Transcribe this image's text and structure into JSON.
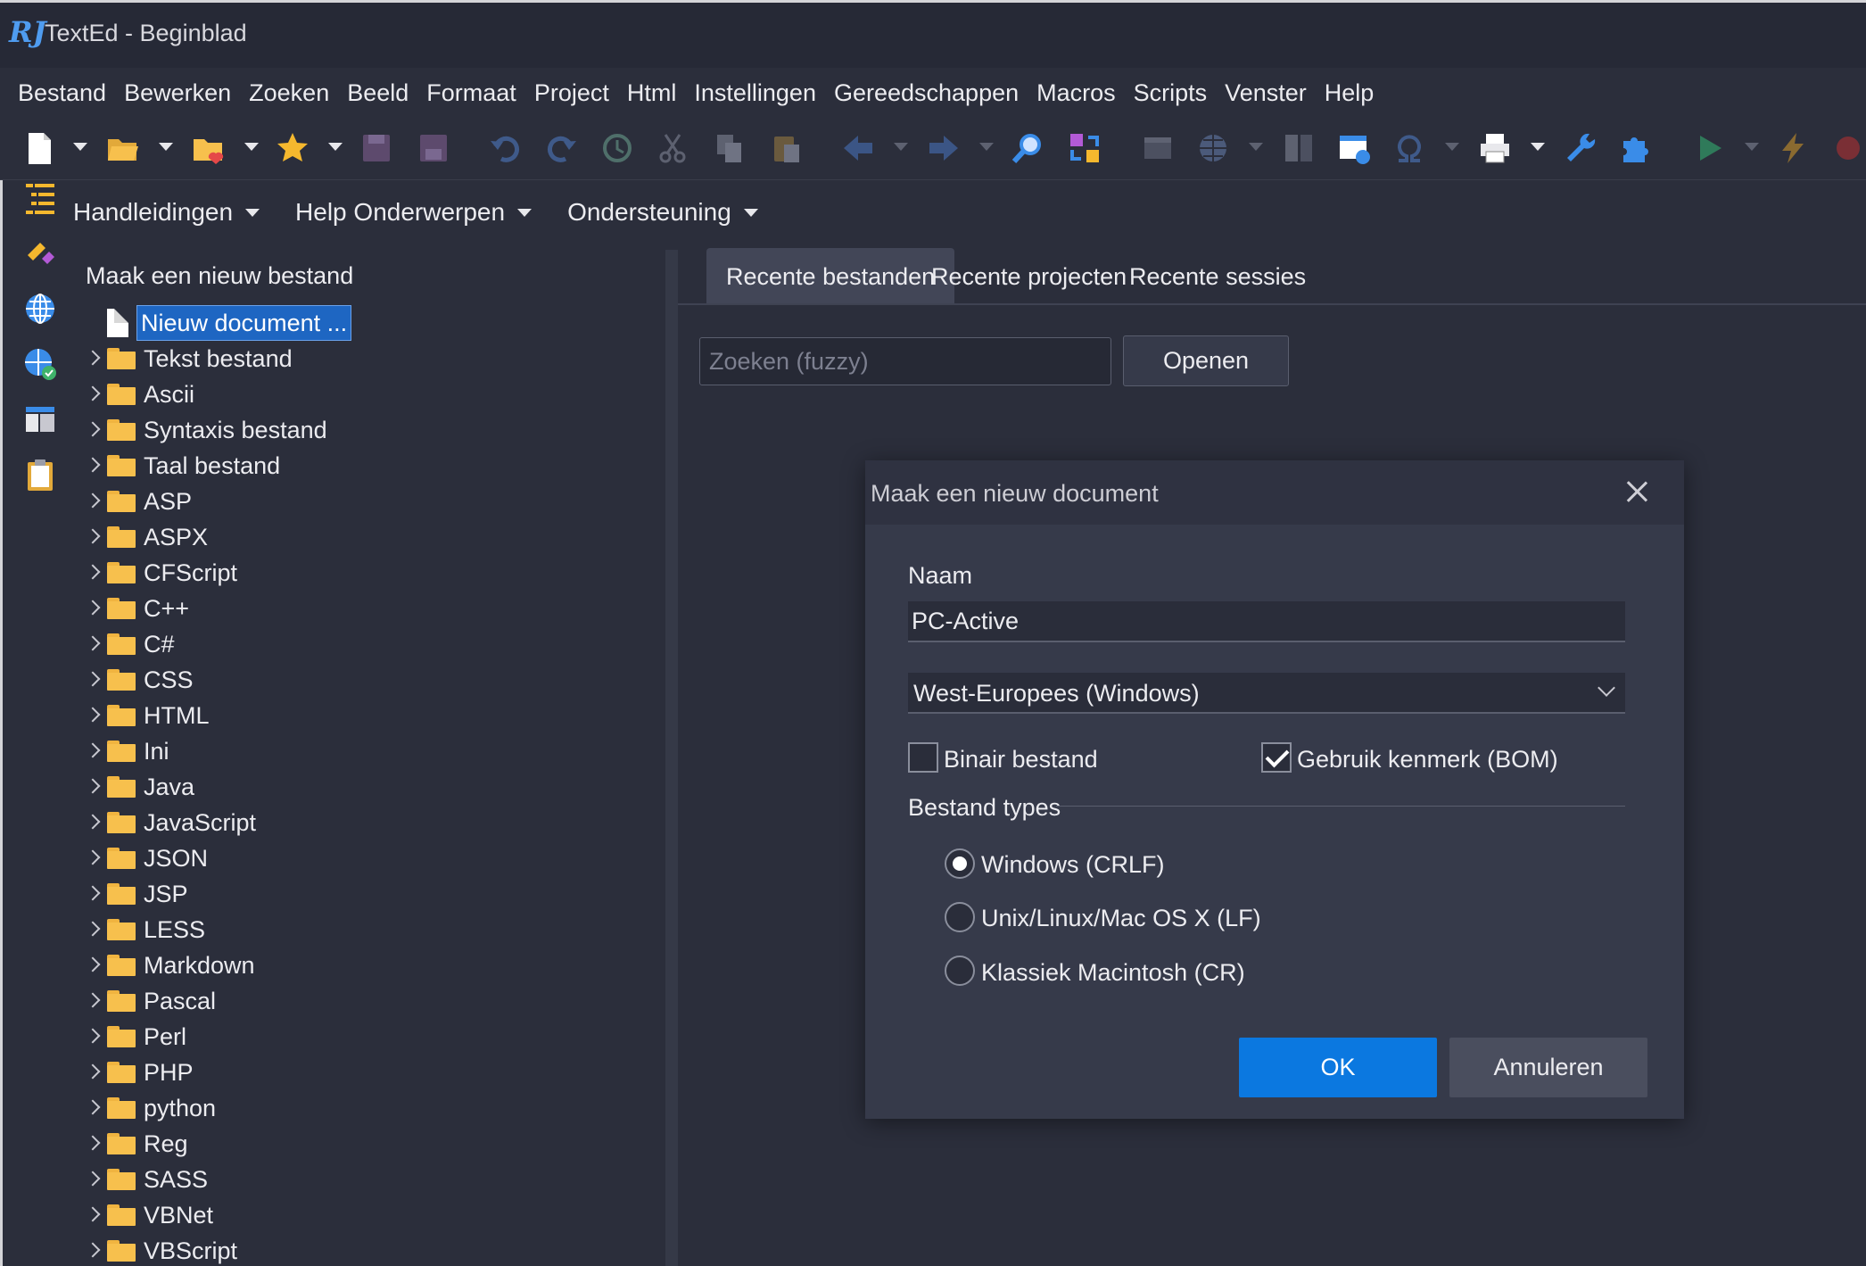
{
  "window": {
    "title": "TextEd - Beginblad",
    "logo_text": "RJ"
  },
  "menu": [
    "Bestand",
    "Bewerken",
    "Zoeken",
    "Beeld",
    "Formaat",
    "Project",
    "Html",
    "Instellingen",
    "Gereedschappen",
    "Macros",
    "Scripts",
    "Venster",
    "Help"
  ],
  "subbar": {
    "items": [
      "Handleidingen",
      "Help Onderwerpen",
      "Ondersteuning"
    ]
  },
  "tree": {
    "heading": "Maak een nieuw bestand",
    "selected_item": "Nieuw document ...",
    "folders": [
      "Tekst bestand",
      "Ascii",
      "Syntaxis bestand",
      "Taal bestand",
      "ASP",
      "ASPX",
      "CFScript",
      "C++",
      "C#",
      "CSS",
      "HTML",
      "Ini",
      "Java",
      "JavaScript",
      "JSON",
      "JSP",
      "LESS",
      "Markdown",
      "Pascal",
      "Perl",
      "PHP",
      "python",
      "Reg",
      "SASS",
      "VBNet",
      "VBScript"
    ]
  },
  "tabs": [
    {
      "label": "Recente bestanden",
      "active": true
    },
    {
      "label": "Recente projecten",
      "active": false
    },
    {
      "label": "Recente sessies",
      "active": false
    }
  ],
  "search": {
    "placeholder": "Zoeken (fuzzy)",
    "value": "",
    "open_label": "Openen"
  },
  "dialog": {
    "title": "Maak een nieuw document",
    "name_label": "Naam",
    "name_value": "PC-Active",
    "encoding_selected": "West-Europees (Windows)",
    "binary_label": "Binair bestand",
    "binary_checked": false,
    "bom_label": "Gebruik kenmerk (BOM)",
    "bom_checked": true,
    "filetypes_label": "Bestand types",
    "line_endings": [
      {
        "label": "Windows (CRLF)",
        "checked": true
      },
      {
        "label": "Unix/Linux/Mac OS X (LF)",
        "checked": false
      },
      {
        "label": "Klassiek Macintosh (CR)",
        "checked": false
      }
    ],
    "ok_label": "OK",
    "cancel_label": "Annuleren"
  },
  "colors": {
    "background": "#2b2e3b",
    "accent": "#0b78e0",
    "selection": "#1e66c2",
    "folder": "#f7c04d"
  }
}
